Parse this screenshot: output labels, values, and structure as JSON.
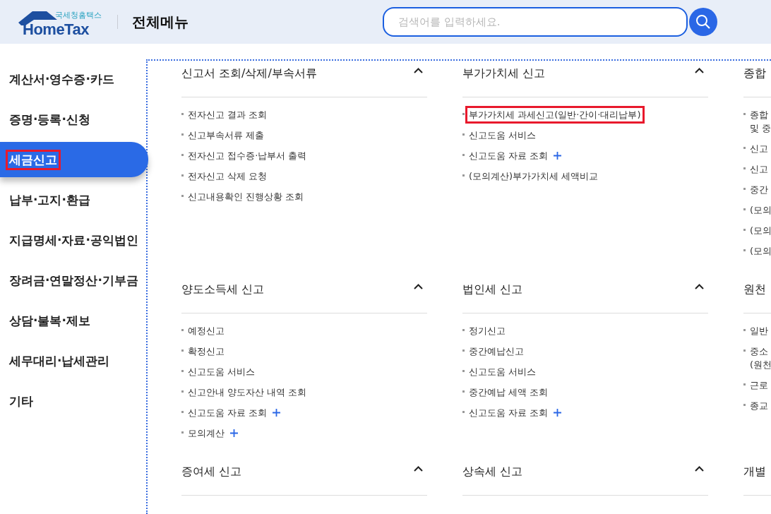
{
  "header": {
    "logo": {
      "tagline": "국세청홈택스",
      "wordmark": "HomeTax"
    },
    "title": "전체메뉴",
    "search": {
      "placeholder": "검색어를 입력하세요."
    }
  },
  "sidebar": {
    "items": [
      {
        "label": "계산서·영수증·카드",
        "selected": false,
        "highlighted": false
      },
      {
        "label": "증명·등록·신청",
        "selected": false,
        "highlighted": false
      },
      {
        "label": "세금신고",
        "selected": true,
        "highlighted": true
      },
      {
        "label": "납부·고지·환급",
        "selected": false,
        "highlighted": false
      },
      {
        "label": "지급명세·자료·공익법인",
        "selected": false,
        "highlighted": false
      },
      {
        "label": "장려금·연말정산·기부금",
        "selected": false,
        "highlighted": false
      },
      {
        "label": "상담·불복·제보",
        "selected": false,
        "highlighted": false
      },
      {
        "label": "세무대리·납세관리",
        "selected": false,
        "highlighted": false
      },
      {
        "label": "기타",
        "selected": false,
        "highlighted": false
      }
    ]
  },
  "sections": [
    {
      "title": "신고서 조회/삭제/부속서류",
      "expanded": true,
      "items": [
        {
          "text": "전자신고 결과 조회",
          "plus": false,
          "highlighted": false
        },
        {
          "text": "신고부속서류 제출",
          "plus": false,
          "highlighted": false
        },
        {
          "text": "전자신고 접수증·납부서 출력",
          "plus": false,
          "highlighted": false
        },
        {
          "text": "전자신고 삭제 요청",
          "plus": false,
          "highlighted": false
        },
        {
          "text": "신고내용확인 진행상황 조회",
          "plus": false,
          "highlighted": false
        }
      ]
    },
    {
      "title": "부가가치세 신고",
      "expanded": true,
      "items": [
        {
          "text": "부가가치세 과세신고(일반·간이·대리납부)",
          "plus": false,
          "highlighted": true
        },
        {
          "text": "신고도움 서비스",
          "plus": false,
          "highlighted": false
        },
        {
          "text": "신고도움 자료 조회",
          "plus": true,
          "highlighted": false
        },
        {
          "text": "(모의계산)부가가치세 세액비교",
          "plus": false,
          "highlighted": false
        }
      ]
    },
    {
      "title": "종합",
      "items": [
        {
          "text": "종합\n및 중",
          "plus": false,
          "highlighted": false
        },
        {
          "text": "신고",
          "plus": false,
          "highlighted": false
        },
        {
          "text": "신고",
          "plus": false,
          "highlighted": false
        },
        {
          "text": "중간",
          "plus": false,
          "highlighted": false
        },
        {
          "text": "(모의",
          "plus": false,
          "highlighted": false
        },
        {
          "text": "(모의",
          "plus": false,
          "highlighted": false
        },
        {
          "text": "(모의",
          "plus": false,
          "highlighted": false
        }
      ]
    },
    {
      "title": "양도소득세 신고",
      "expanded": true,
      "items": [
        {
          "text": "예정신고",
          "plus": false,
          "highlighted": false
        },
        {
          "text": "확정신고",
          "plus": false,
          "highlighted": false
        },
        {
          "text": "신고도움 서비스",
          "plus": false,
          "highlighted": false
        },
        {
          "text": "신고안내 양도자산 내역 조회",
          "plus": false,
          "highlighted": false
        },
        {
          "text": "신고도움 자료 조회",
          "plus": true,
          "highlighted": false
        },
        {
          "text": "모의계산",
          "plus": true,
          "highlighted": false
        }
      ]
    },
    {
      "title": "법인세 신고",
      "expanded": true,
      "items": [
        {
          "text": "정기신고",
          "plus": false,
          "highlighted": false
        },
        {
          "text": "중간예납신고",
          "plus": false,
          "highlighted": false
        },
        {
          "text": "신고도움 서비스",
          "plus": false,
          "highlighted": false
        },
        {
          "text": "중간예납 세액 조회",
          "plus": false,
          "highlighted": false
        },
        {
          "text": "신고도움 자료 조회",
          "plus": true,
          "highlighted": false
        }
      ]
    },
    {
      "title": "원천",
      "items": [
        {
          "text": "일반",
          "plus": false,
          "highlighted": false
        },
        {
          "text": "중소\n(원천",
          "plus": false,
          "highlighted": false
        },
        {
          "text": "근로",
          "plus": false,
          "highlighted": false
        },
        {
          "text": "종교",
          "plus": false,
          "highlighted": false
        }
      ]
    },
    {
      "title": "증여세 신고",
      "expanded": true
    },
    {
      "title": "상속세 신고",
      "expanded": true
    },
    {
      "title": "개별"
    }
  ]
}
